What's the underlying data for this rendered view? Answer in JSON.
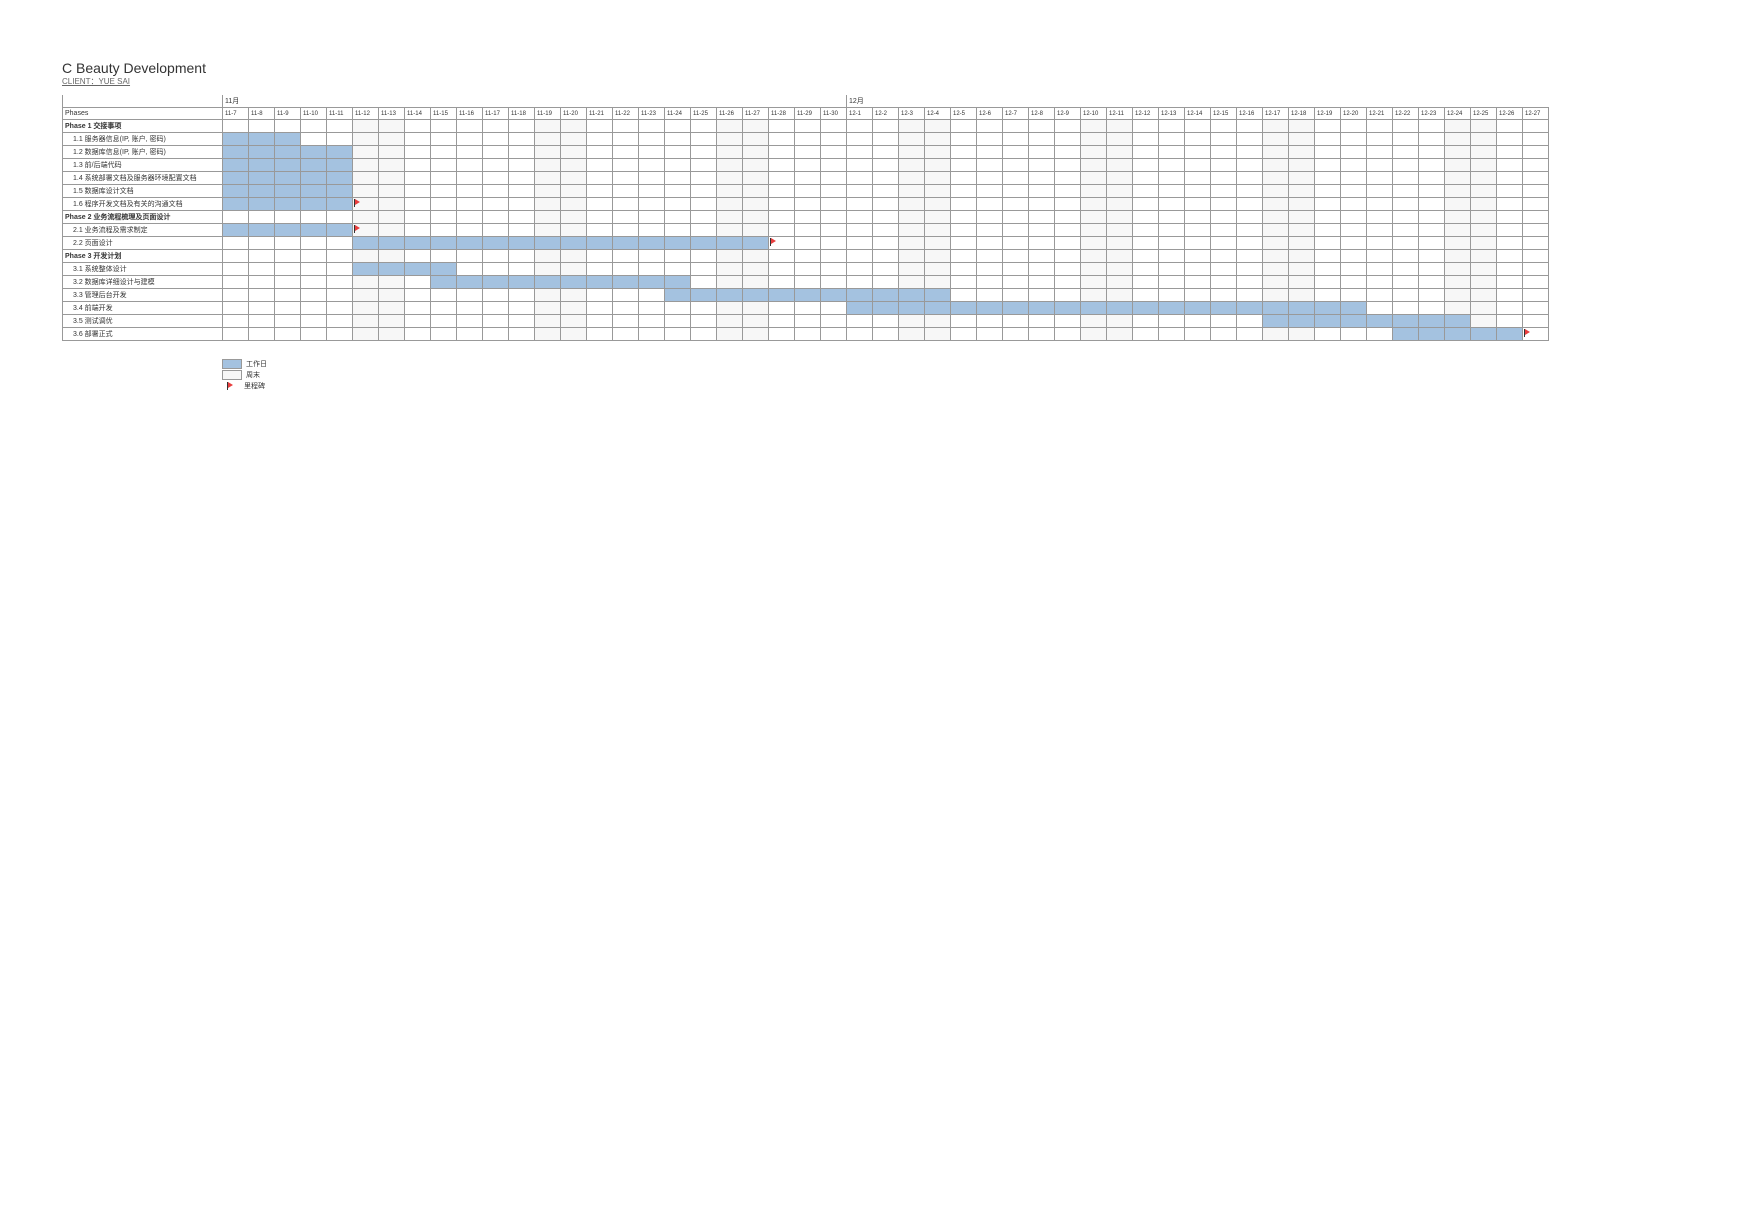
{
  "title": "C Beauty Development",
  "client": "CLIENT：YUE SAI",
  "column_header_label": "Phases",
  "legend": {
    "work": "工作日",
    "weekend": "周末",
    "milestone": "里程碑"
  },
  "chart_data": {
    "type": "gantt",
    "months": [
      {
        "label": "11月",
        "span": 24
      },
      {
        "label": "12月",
        "span": 27
      }
    ],
    "dates": [
      "11-7",
      "11-8",
      "11-9",
      "11-10",
      "11-11",
      "11-12",
      "11-13",
      "11-14",
      "11-15",
      "11-16",
      "11-17",
      "11-18",
      "11-19",
      "11-20",
      "11-21",
      "11-22",
      "11-23",
      "11-24",
      "11-25",
      "11-26",
      "11-27",
      "11-28",
      "11-29",
      "11-30",
      "12-1",
      "12-2",
      "12-3",
      "12-4",
      "12-5",
      "12-6",
      "12-7",
      "12-8",
      "12-9",
      "12-10",
      "12-11",
      "12-12",
      "12-13",
      "12-14",
      "12-15",
      "12-16",
      "12-17",
      "12-18",
      "12-19",
      "12-20",
      "12-21",
      "12-22",
      "12-23",
      "12-24",
      "12-25",
      "12-26",
      "12-27"
    ],
    "weekends": [
      5,
      6,
      12,
      13,
      19,
      20,
      26,
      27,
      33,
      34,
      40,
      41,
      47,
      48
    ],
    "rows": [
      {
        "type": "phase",
        "label": "Phase 1 交接事项"
      },
      {
        "type": "task",
        "label": "1.1 服务器信息(IP, 账户, 密码)",
        "bars": [
          [
            0,
            3
          ]
        ]
      },
      {
        "type": "task",
        "label": "1.2 数据库信息(IP, 账户, 密码)",
        "bars": [
          [
            0,
            5
          ]
        ]
      },
      {
        "type": "task",
        "label": "1.3 前/后端代码",
        "bars": [
          [
            0,
            5
          ]
        ]
      },
      {
        "type": "task",
        "label": "1.4 系统部署文档及服务器环境配置文档",
        "bars": [
          [
            0,
            5
          ]
        ]
      },
      {
        "type": "task",
        "label": "1.5 数据库设计文档",
        "bars": [
          [
            0,
            5
          ]
        ]
      },
      {
        "type": "task",
        "label": "1.6 程序开发文档及有关的沟通文档",
        "bars": [
          [
            0,
            5
          ]
        ],
        "flag": 5
      },
      {
        "type": "phase",
        "label": "Phase 2 业务流程梳理及页面设计"
      },
      {
        "type": "task",
        "label": "2.1 业务流程及需求制定",
        "bars": [
          [
            0,
            5
          ]
        ],
        "flag": 5
      },
      {
        "type": "task",
        "label": "2.2 页面设计",
        "bars": [
          [
            5,
            21
          ]
        ],
        "flag": 21
      },
      {
        "type": "phase",
        "label": "Phase 3 开发计划"
      },
      {
        "type": "task",
        "label": "3.1 系统整体设计",
        "bars": [
          [
            5,
            9
          ]
        ]
      },
      {
        "type": "task",
        "label": "3.2 数据库详细设计与建模",
        "bars": [
          [
            8,
            18
          ]
        ]
      },
      {
        "type": "task",
        "label": "3.3 管理后台开发",
        "bars": [
          [
            17,
            28
          ]
        ]
      },
      {
        "type": "task",
        "label": "3.4 前端开发",
        "bars": [
          [
            24,
            44
          ]
        ]
      },
      {
        "type": "task",
        "label": "3.5 测试调优",
        "bars": [
          [
            40,
            48
          ]
        ]
      },
      {
        "type": "task",
        "label": "3.6 部署正式",
        "bars": [
          [
            45,
            50
          ]
        ],
        "flag": 50
      }
    ]
  }
}
